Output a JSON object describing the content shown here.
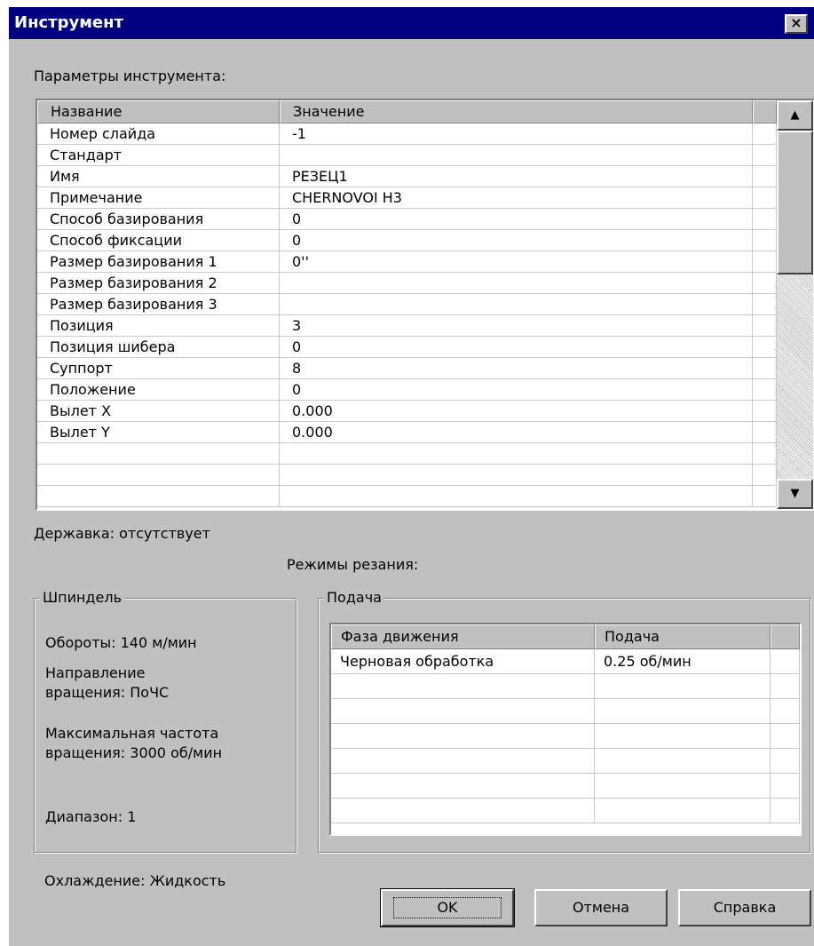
{
  "window": {
    "title": "Инструмент",
    "close_glyph": "×"
  },
  "params_label": "Параметры инструмента:",
  "params_table": {
    "columns": [
      "Название",
      "Значение"
    ],
    "rows": [
      [
        "Номер слайда",
        "-1"
      ],
      [
        "Стандарт",
        ""
      ],
      [
        "Имя",
        "РЕЗЕЦ1"
      ],
      [
        "Примечание",
        "CHERNOVOI H3"
      ],
      [
        "Способ базирования",
        "0"
      ],
      [
        "Способ фиксации",
        "0"
      ],
      [
        "Размер базирования 1",
        "0''"
      ],
      [
        "Размер базирования 2",
        ""
      ],
      [
        "Размер базирования 3",
        ""
      ],
      [
        "Позиция",
        "3"
      ],
      [
        "Позиция шибера",
        "0"
      ],
      [
        "Суппорт",
        "8"
      ],
      [
        "Положение",
        "0"
      ],
      [
        "Вылет X",
        "0.000"
      ],
      [
        "Вылет Y",
        "0.000"
      ]
    ],
    "scroll_up_glyph": "▲",
    "scroll_down_glyph": "▼"
  },
  "holder_label": "Державка: отсутствует",
  "cutting_modes_label": "Режимы резания:",
  "spindle": {
    "title": "Шпиндель",
    "rpm": "Обороты: 140 м/мин",
    "direction_line1": "Направление",
    "direction_line2": "вращения: ПоЧС",
    "maxfreq_line1": "Максимальная частота",
    "maxfreq_line2": "вращения: 3000 об/мин",
    "range": "Диапазон: 1"
  },
  "feed": {
    "title": "Подача",
    "columns": [
      "Фаза движения",
      "Подача"
    ],
    "rows": [
      [
        "Черновая обработка",
        "0.25 об/мин"
      ]
    ]
  },
  "cooling_label": "Охлаждение: Жидкость",
  "buttons": {
    "ok": "OK",
    "cancel": "Отмена",
    "help": "Справка"
  }
}
